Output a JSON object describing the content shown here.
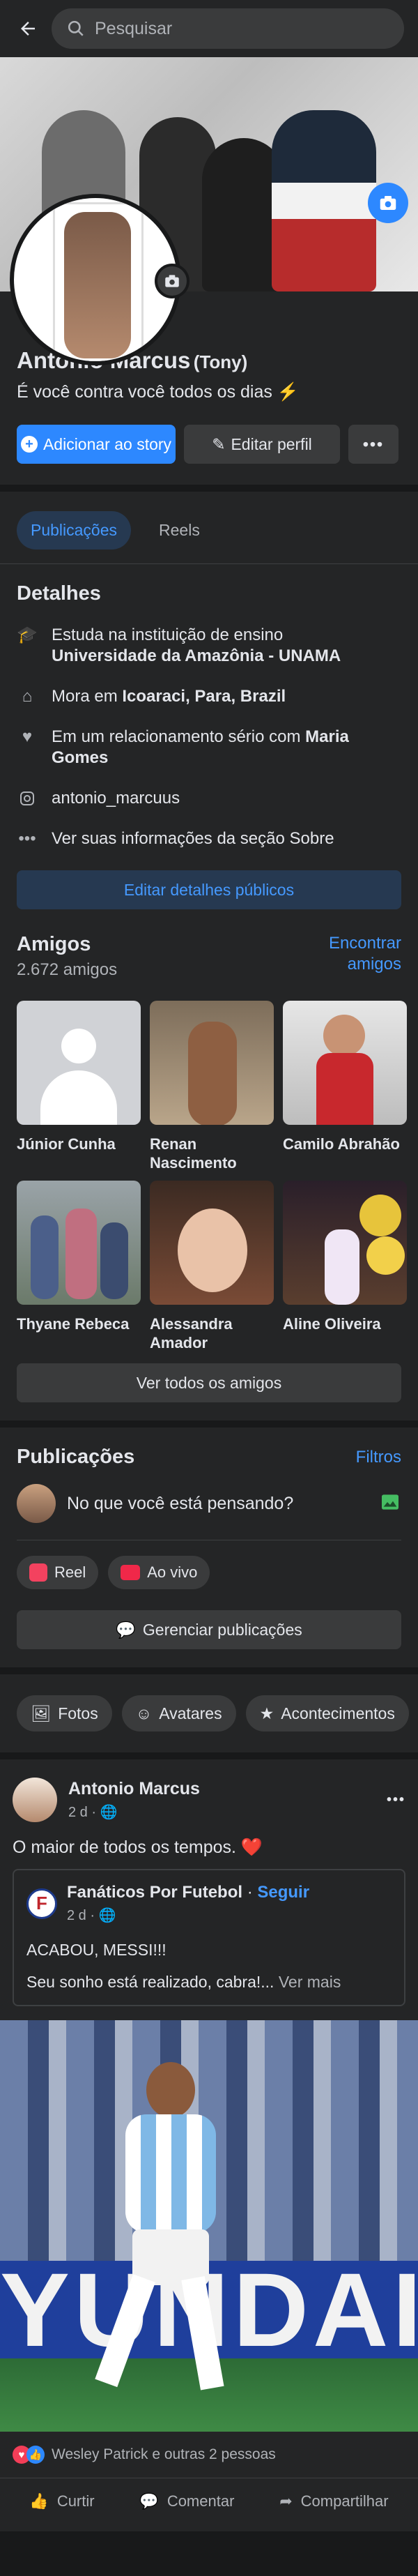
{
  "search": {
    "placeholder": "Pesquisar"
  },
  "profile": {
    "name": "Antonio Marcus",
    "nickname": "(Tony)",
    "bio": "É você contra você todos os dias",
    "add_story": "Adicionar ao story",
    "edit_profile": "Editar perfil"
  },
  "tabs": [
    {
      "label": "Publicações"
    },
    {
      "label": "Reels"
    }
  ],
  "details": {
    "title": "Detalhes",
    "education_prefix": "Estuda na instituição de ensino",
    "education_value": "Universidade da Amazônia - UNAMA",
    "city_prefix": "Mora em",
    "city_value": "Icoaraci, Para, Brazil",
    "relationship_prefix": "Em um relacionamento sério com",
    "relationship_value": "Maria Gomes",
    "instagram": "antonio_marcuus",
    "about": "Ver suas informações da seção Sobre",
    "edit_public": "Editar detalhes públicos"
  },
  "friends": {
    "title": "Amigos",
    "count": "2.672 amigos",
    "find": "Encontrar amigos",
    "see_all": "Ver todos os amigos",
    "list": [
      {
        "name": "Júnior Cunha"
      },
      {
        "name": "Renan Nascimento"
      },
      {
        "name": "Camilo Abrahão"
      },
      {
        "name": "Thyane Rebeca"
      },
      {
        "name": "Alessandra Amador"
      },
      {
        "name": "Aline Oliveira"
      }
    ]
  },
  "publications": {
    "title": "Publicações",
    "filters": "Filtros",
    "composer_placeholder": "No que você está pensando?",
    "reel": "Reel",
    "live": "Ao vivo",
    "manage": "Gerenciar publicações"
  },
  "filter_chips": [
    {
      "label": "Fotos"
    },
    {
      "label": "Avatares"
    },
    {
      "label": "Acontecimentos"
    }
  ],
  "post": {
    "author": "Antonio Marcus",
    "time": "2 d ·",
    "text": "O maior de todos os tempos. ❤️",
    "shared": {
      "page": "Fanáticos Por Futebol",
      "dot": "·",
      "follow": "Seguir",
      "time": "2 d ·",
      "line1": "ACABOU, MESSI!!!",
      "line2": "Seu sonho está realizado, cabra!...",
      "see_more": "Ver mais"
    },
    "banner_text": "YUNDAI",
    "reactions": "Wesley Patrick e outras 2 pessoas",
    "like": "Curtir",
    "comment": "Comentar",
    "share": "Compartilhar"
  },
  "colors": {
    "accent": "#2d88ff",
    "link": "#4599ff",
    "background": "#18191a",
    "card": "#242526"
  }
}
